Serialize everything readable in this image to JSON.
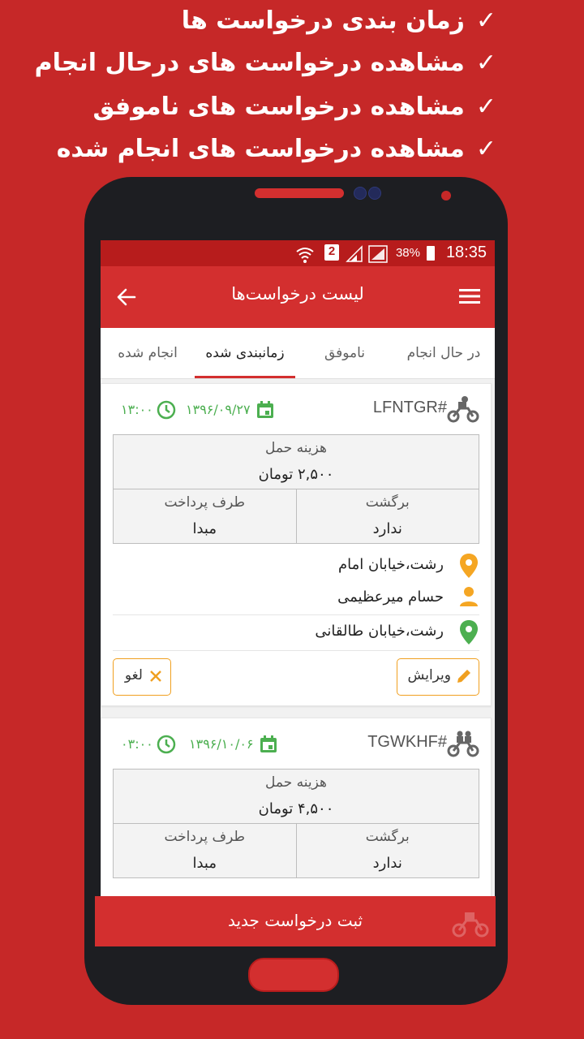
{
  "promo": {
    "lines": [
      "زمان بندی درخواست ها",
      "مشاهده درخواست های درحال انجام",
      "مشاهده درخواست های ناموفق",
      "مشاهده درخواست های انجام شده"
    ],
    "check_mark": "✓"
  },
  "status_bar": {
    "time": "18:35",
    "battery_percent": "38%",
    "sim_badge": "2",
    "icons": [
      "wifi-icon",
      "sim-2-icon",
      "signal-icon",
      "signal-icon",
      "battery-charging-icon"
    ]
  },
  "toolbar": {
    "title": "لیست درخواست‌ها",
    "menu_icon": "hamburger-menu-icon",
    "back_icon": "arrow-left-icon"
  },
  "tabs": [
    {
      "label": "در حال انجام",
      "active": false
    },
    {
      "label": "ناموفق",
      "active": false
    },
    {
      "label": "زمانبندی شده",
      "active": true
    },
    {
      "label": "انجام شده",
      "active": false
    }
  ],
  "requests": [
    {
      "code": "LFNTGR#",
      "date": "۱۳۹۶/۰۹/۲۷",
      "time": "۱۳:۰۰",
      "cost_label": "هزینه حمل",
      "cost_value": "۲,۵۰۰ تومان",
      "return_label": "برگشت",
      "return_value": "ندارد",
      "payer_label": "طرف پرداخت",
      "payer_value": "مبدا",
      "origin": "رشت،خیابان امام",
      "contact": "حسام میرعظیمی",
      "destination": "رشت،خیابان طالقانی",
      "edit_label": "ویرایش",
      "cancel_label": "لغو"
    },
    {
      "code": "TGWKHF#",
      "date": "۱۳۹۶/۱۰/۰۶",
      "time": "۰۳:۰۰",
      "cost_label": "هزینه حمل",
      "cost_value": "۴,۵۰۰ تومان",
      "return_label": "برگشت",
      "return_value": "ندارد",
      "payer_label": "طرف پرداخت",
      "payer_value": "مبدا"
    }
  ],
  "bottom_action": {
    "label": "ثبت درخواست جدید"
  },
  "colors": {
    "primary": "#d32f2f",
    "primary_dark": "#b71c1c",
    "accent_green": "#4caf50",
    "accent_orange": "#f0a020",
    "background": "#c62828"
  }
}
